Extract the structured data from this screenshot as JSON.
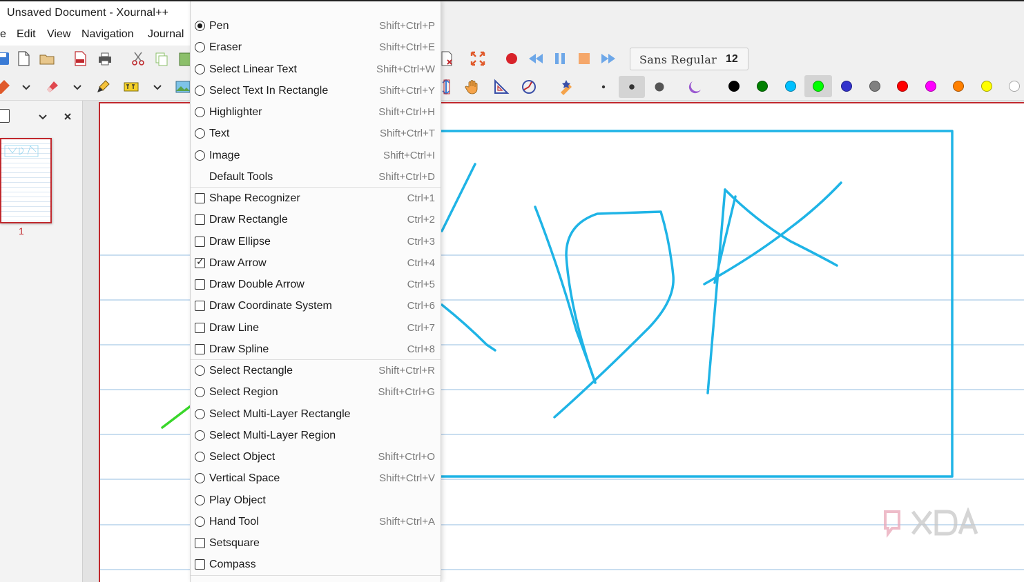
{
  "window": {
    "title": "Unsaved Document - Xournal++"
  },
  "menubar": {
    "items": [
      {
        "label": "e"
      },
      {
        "label": "Edit"
      },
      {
        "label": "View"
      },
      {
        "label": "Navigation"
      },
      {
        "label": "Journal"
      }
    ]
  },
  "toolbar": {
    "font_name": "Sans Regular",
    "font_size": "12"
  },
  "colors": {
    "accent_red": "#c0282d",
    "ink_blue": "#1fb4e6",
    "palette": [
      "#000000",
      "#008000",
      "#00c0ff",
      "#00ff00",
      "#3333cc",
      "#808080",
      "#ff0000",
      "#ff00ff",
      "#ff8000",
      "#ffff00",
      "#ffffff"
    ],
    "selected_palette_index": 3
  },
  "sidebar": {
    "page_number": "1"
  },
  "tool_menu": {
    "items": [
      {
        "type": "radio",
        "checked": true,
        "label": "Pen",
        "accel": "Shift+Ctrl+P"
      },
      {
        "type": "radio",
        "checked": false,
        "label": "Eraser",
        "accel": "Shift+Ctrl+E"
      },
      {
        "type": "radio",
        "checked": false,
        "label": "Select Linear Text",
        "accel": "Shift+Ctrl+W"
      },
      {
        "type": "radio",
        "checked": false,
        "label": "Select Text In Rectangle",
        "accel": "Shift+Ctrl+Y"
      },
      {
        "type": "radio",
        "checked": false,
        "label": "Highlighter",
        "accel": "Shift+Ctrl+H"
      },
      {
        "type": "radio",
        "checked": false,
        "label": "Text",
        "accel": "Shift+Ctrl+T"
      },
      {
        "type": "radio",
        "checked": false,
        "label": "Image",
        "accel": "Shift+Ctrl+I"
      },
      {
        "type": "plain",
        "checked": false,
        "label": "Default Tools",
        "accel": "Shift+Ctrl+D"
      },
      {
        "type": "check",
        "checked": false,
        "label": "Shape Recognizer",
        "accel": "Ctrl+1"
      },
      {
        "type": "check",
        "checked": false,
        "label": "Draw Rectangle",
        "accel": "Ctrl+2"
      },
      {
        "type": "check",
        "checked": false,
        "label": "Draw Ellipse",
        "accel": "Ctrl+3"
      },
      {
        "type": "check",
        "checked": true,
        "label": "Draw Arrow",
        "accel": "Ctrl+4"
      },
      {
        "type": "check",
        "checked": false,
        "label": "Draw Double Arrow",
        "accel": "Ctrl+5"
      },
      {
        "type": "check",
        "checked": false,
        "label": "Draw Coordinate System",
        "accel": "Ctrl+6"
      },
      {
        "type": "check",
        "checked": false,
        "label": "Draw Line",
        "accel": "Ctrl+7"
      },
      {
        "type": "check",
        "checked": false,
        "label": "Draw Spline",
        "accel": "Ctrl+8"
      },
      {
        "type": "radio",
        "checked": false,
        "label": "Select Rectangle",
        "accel": "Shift+Ctrl+R"
      },
      {
        "type": "radio",
        "checked": false,
        "label": "Select Region",
        "accel": "Shift+Ctrl+G"
      },
      {
        "type": "radio",
        "checked": false,
        "label": "Select Multi-Layer Rectangle",
        "accel": ""
      },
      {
        "type": "radio",
        "checked": false,
        "label": "Select Multi-Layer Region",
        "accel": ""
      },
      {
        "type": "radio",
        "checked": false,
        "label": "Select Object",
        "accel": "Shift+Ctrl+O"
      },
      {
        "type": "radio",
        "checked": false,
        "label": "Vertical Space",
        "accel": "Shift+Ctrl+V"
      },
      {
        "type": "radio",
        "checked": false,
        "label": "Play Object",
        "accel": ""
      },
      {
        "type": "radio",
        "checked": false,
        "label": "Hand Tool",
        "accel": "Shift+Ctrl+A"
      },
      {
        "type": "check",
        "checked": false,
        "label": "Setsquare",
        "accel": ""
      },
      {
        "type": "check",
        "checked": false,
        "label": "Compass",
        "accel": ""
      }
    ]
  }
}
